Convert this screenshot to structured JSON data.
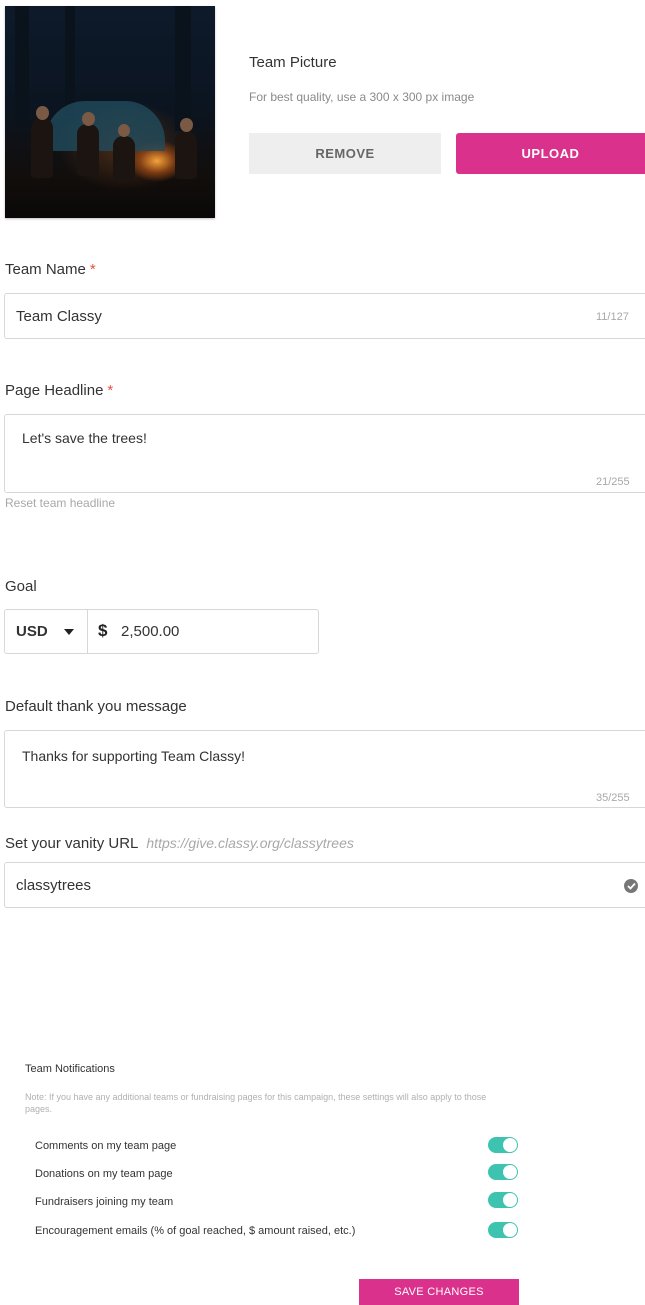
{
  "team_picture": {
    "title": "Team Picture",
    "hint": "For best quality, use a 300 x 300 px image",
    "remove_label": "REMOVE",
    "upload_label": "UPLOAD"
  },
  "team_name": {
    "label": "Team Name",
    "required_mark": "*",
    "value": "Team Classy",
    "counter": "11/127"
  },
  "page_headline": {
    "label": "Page Headline",
    "required_mark": "*",
    "value": "Let's save the trees!",
    "counter": "21/255",
    "reset_link": "Reset team headline"
  },
  "goal": {
    "label": "Goal",
    "currency": "USD",
    "currency_symbol": "$",
    "amount": "2,500.00"
  },
  "thank_you": {
    "label": "Default thank you message",
    "value": "Thanks for supporting Team Classy!",
    "counter": "35/255"
  },
  "vanity_url": {
    "label": "Set your vanity URL",
    "base_url": "https://give.classy.org/classytrees",
    "value": "classytrees"
  },
  "notifications": {
    "title": "Team Notifications",
    "note": "Note: If you have any additional teams or fundraising pages for this campaign, these settings will also apply to those pages.",
    "items": [
      {
        "label": "Comments on my team page",
        "enabled": true
      },
      {
        "label": "Donations on my team page",
        "enabled": true
      },
      {
        "label": "Fundraisers joining my team",
        "enabled": true
      },
      {
        "label": "Encouragement emails (% of goal reached, $ amount raised, etc.)",
        "enabled": true
      }
    ],
    "save_label": "SAVE CHANGES"
  },
  "colors": {
    "accent": "#d9318c",
    "toggle_on": "#3ec3b0",
    "required": "#e5533d"
  }
}
